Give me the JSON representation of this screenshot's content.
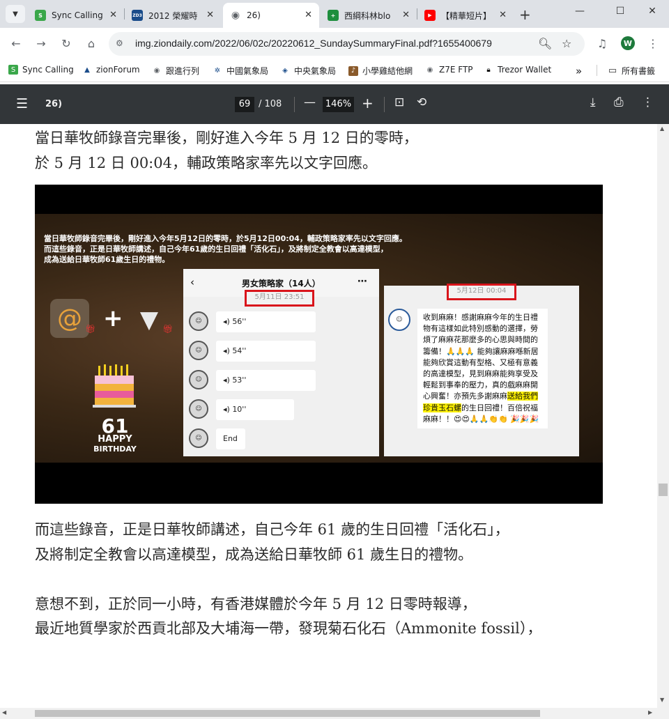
{
  "browser": {
    "tabs": [
      {
        "title": "Sync Calling",
        "fav_color": "#3aa74a",
        "fav_text": "S"
      },
      {
        "title": "2012 榮耀時",
        "fav_color": "#1a4c8a",
        "fav_text": "ZD3"
      },
      {
        "title": "26)",
        "fav_color": "#5f6368",
        "fav_text": ""
      },
      {
        "title": "西綱科林blo",
        "fav_color": "#1e8e3e",
        "fav_text": "+"
      },
      {
        "title": "【精華短片】",
        "fav_color": "#ff0000",
        "fav_text": "▶"
      }
    ],
    "url": "img.ziondaily.com/2022/06/02c/20220612_SundaySummaryFinal.pdf?1655400679",
    "profile_initial": "W"
  },
  "bookmarks": [
    {
      "label": "Sync Calling",
      "icon": "sync-calling-icon"
    },
    {
      "label": "zionForum",
      "icon": "zionforum-icon"
    },
    {
      "label": "跟進行列",
      "icon": "globe-icon"
    },
    {
      "label": "中國氣象局",
      "icon": "cma-icon"
    },
    {
      "label": "中央氣象局",
      "icon": "cwb-icon"
    },
    {
      "label": "小學雞結他網",
      "icon": "guitar-icon"
    },
    {
      "label": "Z7E FTP",
      "icon": "globe-icon"
    },
    {
      "label": "Trezor Wallet",
      "icon": "lock-icon"
    },
    {
      "label": "所有書籤",
      "icon": "folder-icon"
    }
  ],
  "pdf": {
    "title": "26)",
    "page_current": "69",
    "page_total": "/ 108",
    "zoom": "146%"
  },
  "document": {
    "para1": [
      "當日華牧師錄音完畢後，剛好進入今年 5 月 12 日的零時，",
      "於 5 月 12 日 00:04，輔政策略家率先以文字回應。"
    ],
    "para2": [
      "而這些錄音，正是日華牧師講述，自己今年 61 歲的生日回禮「活化石」，",
      "及將制定全教會以高達模型，成為送給日華牧師 61 歲生日的禮物。"
    ],
    "para3": [
      "意想不到，正於同一小時，有香港媒體於今年 5 月 12 日零時報導，",
      "最近地質學家於西貢北部及大埔海一帶，發現菊石化石（Ammonite fossil），"
    ]
  },
  "slide": {
    "caption": [
      "當日華牧師錄音完畢後，剛好進入今年5月12日的零時，於5月12日00:04，輔政策略家率先以文字回應。",
      "而這些錄音，正是日華牧師講述，自己今年61歲的生日回禮「活化石」，及將制定全教會以高達模型，",
      "成為送給日華牧師61歲生日的禮物。"
    ],
    "cake_number": "61",
    "happy": "HAPPY",
    "birthday": "BIRTHDAY",
    "chat_left": {
      "group_name": "男女策略家（14人）",
      "timestamp": "5月11日 23:51",
      "voice_messages": [
        "56''",
        "54''",
        "53''",
        "10''"
      ],
      "last_message": "End"
    },
    "chat_right": {
      "timestamp": "5月12日 00:04",
      "message_before": "收到麻麻！感謝麻麻今年的生日禮物有這樣如此特別感動的選擇，勞煩了麻麻花那麼多的心思與時間的籌備！🙏🙏🙏 能夠讓麻麻喺新居能夠欣賞這動有型格、又極有意義的高達模型，見到麻麻能夠享受及輕鬆到事奉的壓力，真的戲麻麻開心興奮！亦預先多謝麻麻",
      "message_highlight": "送給我們珍貴玉石螺",
      "message_after": "的生日回禮！百倍祝福麻麻！！😍😍🙏🙏👏👏 🎉🎉🎉"
    }
  }
}
